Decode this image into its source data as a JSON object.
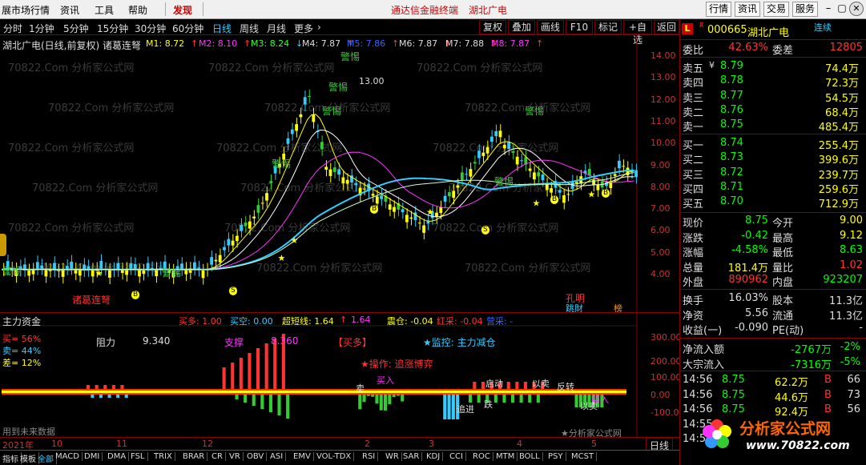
{
  "menu": {
    "items": [
      "展市场行情",
      "资讯",
      "工具",
      "帮助"
    ],
    "discover": "发现",
    "app_title": "通达信金融终端",
    "stock_title": "湖北广电",
    "right_buttons": [
      "行情",
      "资讯",
      "交易",
      "服务"
    ]
  },
  "periods": {
    "items": [
      "分时",
      "1分钟",
      "5分钟",
      "15分钟",
      "30分钟",
      "60分钟",
      "日线",
      "周线",
      "月线",
      "更多"
    ],
    "active": "日线",
    "more_arrow": "›",
    "buttons": [
      "复权",
      "叠加",
      "画线",
      "F10",
      "标记",
      "+自选",
      "返回"
    ]
  },
  "main_chart": {
    "header": "湖北广电(日线,前复权) 诸葛连弩",
    "ma": [
      {
        "label": "M1: 8.72",
        "arrow": "↑",
        "color": "#ffff00"
      },
      {
        "label": "M2: 8.10",
        "arrow": "↑",
        "color": "#ff33ff"
      },
      {
        "label": "M3: 8.24",
        "arrow": "↓",
        "color": "#33ff33"
      },
      {
        "label": "M4: 7.87",
        "arrow": "↑",
        "color": "#dddddd"
      },
      {
        "label": "M5: 7.86",
        "arrow": "↑",
        "color": "#3366ff"
      },
      {
        "label": "M6: 7.87",
        "arrow": "↑",
        "color": "#dddddd"
      },
      {
        "label": "M7: 7.88",
        "arrow": "↑",
        "color": "#dddddd"
      },
      {
        "label": "M8: 7.87",
        "arrow": "↑",
        "color": "#ff33ff"
      }
    ],
    "price_axis": [
      "14.00",
      "13.00",
      "12.00",
      "11.00",
      "10.00",
      "9.00",
      "8.00",
      "7.00",
      "6.00",
      "5.00",
      "4.00"
    ],
    "peak_label": "13.00",
    "annotations": {
      "warn": "警惕",
      "left_warn": "警惕",
      "zhuge": "诸葛连弩",
      "kongming": "孔明",
      "chart_marks": [
        "S",
        "B",
        "B",
        "S",
        "B",
        "B"
      ],
      "tag_a": "跳財",
      "tag_b": "榜"
    }
  },
  "sub_chart": {
    "title": "主力资金",
    "buy_more": "买多: 1.00",
    "buy_empty": "买空: 0.00",
    "ultra": "超短线: 1.64",
    "ultra2": "1.64",
    "arrow_up": "↑",
    "zhencang": "震仓: -0.04",
    "hongcai": "红采: -0.04",
    "yingcai": "营采: -",
    "buy_pct": "买= 56%",
    "sell_pct": "卖= 44%",
    "diff_pct": "差= 12%",
    "resist": "阻力",
    "resist_val": "9.340",
    "support": "支撑",
    "support_val": "8.360",
    "buy_tag": "【买多】",
    "monitor": "★监控: 主力减仓",
    "operate": "★操作: 追涨博弈",
    "axis": [
      "300.00",
      "200.00",
      "100.00",
      "0.00",
      "-100.00"
    ],
    "labels": {
      "buy_in": "买入",
      "sell": "卖",
      "start": "启动",
      "reverse": "反转",
      "zuiyan": "追进",
      "buy2": "买入",
      "yixia": "以卖",
      "tiao": "跌",
      "shuipeng": "以卖"
    },
    "footer_left": "用到未来数据",
    "footer_right": "★分析家公式网"
  },
  "date_axis": [
    "2021年",
    "10",
    "11",
    "12",
    "2",
    "3",
    "4",
    "5"
  ],
  "date_axis_btn": "日线",
  "tabs": [
    "指标",
    "模板",
    "全部",
    "MACD",
    "DMI",
    "DMA",
    "FSL",
    "TRIX",
    "BRAR",
    "CR",
    "VR",
    "OBV",
    "ASI",
    "EMV",
    "VOL-TDX",
    "RSI",
    "WR",
    "SAR",
    "KDJ",
    "CCI",
    "ROC",
    "MTM",
    "BOLL",
    "PSY",
    "MCST"
  ],
  "quote": {
    "badge": "L",
    "badge2": "R",
    "code": "000665",
    "name": "湖北广电",
    "link": "连续",
    "weibi_label": "委比",
    "weibi": "42.63%",
    "weicha_label": "委差",
    "weicha": "12805",
    "sells": [
      {
        "label": "卖五",
        "mark": "¥",
        "price": "8.79",
        "vol": "74.4万"
      },
      {
        "label": "卖四",
        "mark": "",
        "price": "8.78",
        "vol": "72.3万"
      },
      {
        "label": "卖三",
        "mark": "",
        "price": "8.77",
        "vol": "54.5万"
      },
      {
        "label": "卖二",
        "mark": "",
        "price": "8.76",
        "vol": "68.4万"
      },
      {
        "label": "卖一",
        "mark": "",
        "price": "8.75",
        "vol": "485.4万"
      }
    ],
    "buys": [
      {
        "label": "买一",
        "price": "8.74",
        "vol": "255.4万"
      },
      {
        "label": "买二",
        "price": "8.73",
        "vol": "399.6万"
      },
      {
        "label": "买三",
        "price": "8.72",
        "vol": "239.7万"
      },
      {
        "label": "买四",
        "price": "8.71",
        "vol": "259.6万"
      },
      {
        "label": "买五",
        "price": "8.70",
        "vol": "712.9万"
      }
    ],
    "stats": [
      {
        "l1": "现价",
        "v1": "8.75",
        "c1": "grn",
        "l2": "今开",
        "v2": "9.00",
        "c2": "yel"
      },
      {
        "l1": "涨跌",
        "v1": "-0.42",
        "c1": "grn",
        "l2": "最高",
        "v2": "9.12",
        "c2": "yel"
      },
      {
        "l1": "涨幅",
        "v1": "-4.58%",
        "c1": "grn",
        "l2": "最低",
        "v2": "8.63",
        "c2": "grn"
      },
      {
        "l1": "总量",
        "v1": "181.4万",
        "c1": "yel",
        "l2": "量比",
        "v2": "1.02",
        "c2": "red"
      },
      {
        "l1": "外盘",
        "v1": "890962",
        "c1": "red",
        "l2": "内盘",
        "v2": "923207",
        "c2": "grn"
      }
    ],
    "stats2": [
      {
        "l1": "换手",
        "v1": "16.03%",
        "l2": "股本",
        "v2": "11.3亿"
      },
      {
        "l1": "净资",
        "v1": "5.56",
        "l2": "流通",
        "v2": "11.3亿"
      },
      {
        "l1": "收益(一)",
        "v1": "-0.090",
        "l2": "PE(动)",
        "v2": "-"
      }
    ],
    "flows": [
      {
        "label": "净流入额",
        "val": "-2767万",
        "pct": "-2%"
      },
      {
        "label": "大宗流入",
        "val": "-7316万",
        "pct": "-5%"
      }
    ],
    "ticks": [
      {
        "time": "14:56",
        "price": "8.75",
        "vol": "62.2万",
        "dir": "B",
        "n": "66"
      },
      {
        "time": "14:56",
        "price": "8.75",
        "vol": "44.6万",
        "dir": "B",
        "n": "73"
      },
      {
        "time": "14:56",
        "price": "8.75",
        "vol": "92.4万",
        "dir": "B",
        "n": "56"
      },
      {
        "time": "14:55",
        "price": "",
        "vol": "",
        "dir": "",
        "n": ""
      },
      {
        "time": "14:55",
        "price": "",
        "vol": "",
        "dir": "",
        "n": ""
      }
    ],
    "logo_text": "分析家公式网",
    "logo_url": "www.70822.com"
  },
  "watermark": "70822.Com 分析家公式网"
}
